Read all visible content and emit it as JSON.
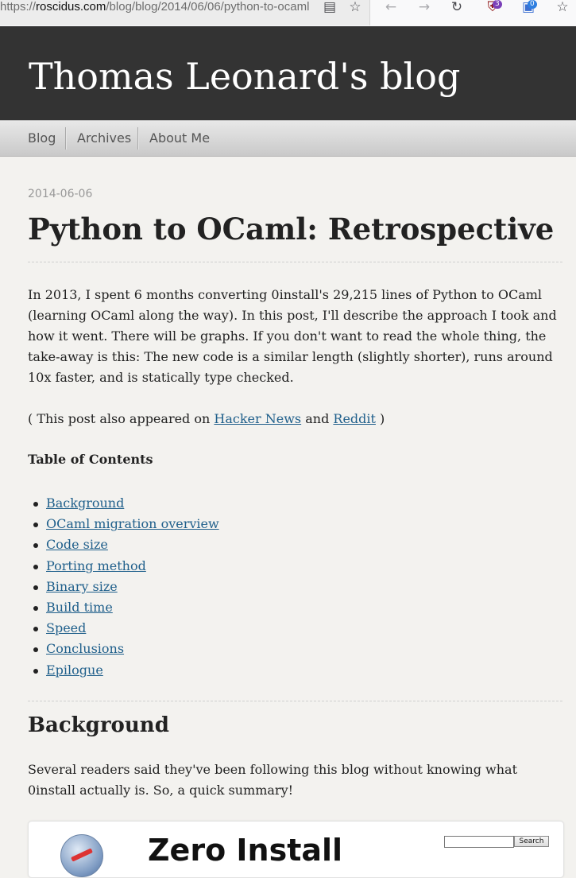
{
  "browser": {
    "url_domain": "roscidus.com",
    "url_path": "/blog/blog/2014/06/06/python-to-ocaml",
    "url_prefix": "https://",
    "icons": [
      "reader-view-icon",
      "bookmark-star-icon",
      "back-arrow-icon",
      "forward-arrow-icon",
      "reload-icon",
      "ublock-icon",
      "extension-icon",
      "bookmarks-icon"
    ],
    "ublock_badge": "3",
    "ext_badge": "0"
  },
  "site": {
    "title": "Thomas Leonard's blog"
  },
  "nav": {
    "items": [
      "Blog",
      "Archives",
      "About Me"
    ]
  },
  "post": {
    "date": "2014-06-06",
    "title": "Python to OCaml: Retrospective",
    "intro": "In 2013, I spent 6 months converting 0install's 29,215 lines of Python to OCaml (learning OCaml along the way). In this post, I'll describe the approach I took and how it went. There will be graphs. If you don't want to read the whole thing, the take-away is this: The new code is a similar length (slightly shorter), runs around 10x faster, and is statically type checked.",
    "also_prefix": "( This post also appeared on ",
    "also_link1": "Hacker News",
    "also_mid": " and ",
    "also_link2": "Reddit",
    "also_suffix": " )",
    "toc_title": "Table of Contents",
    "toc": [
      "Background",
      "OCaml migration overview",
      "Code size",
      "Porting method",
      "Binary size",
      "Build time",
      "Speed",
      "Conclusions",
      "Epilogue"
    ],
    "section_heading": "Background",
    "section_text": "Several readers said they've been following this blog without knowing what 0install actually is. So, a quick summary!"
  },
  "embed": {
    "title": "Zero Install",
    "search_button": "Search",
    "search_value": ""
  }
}
